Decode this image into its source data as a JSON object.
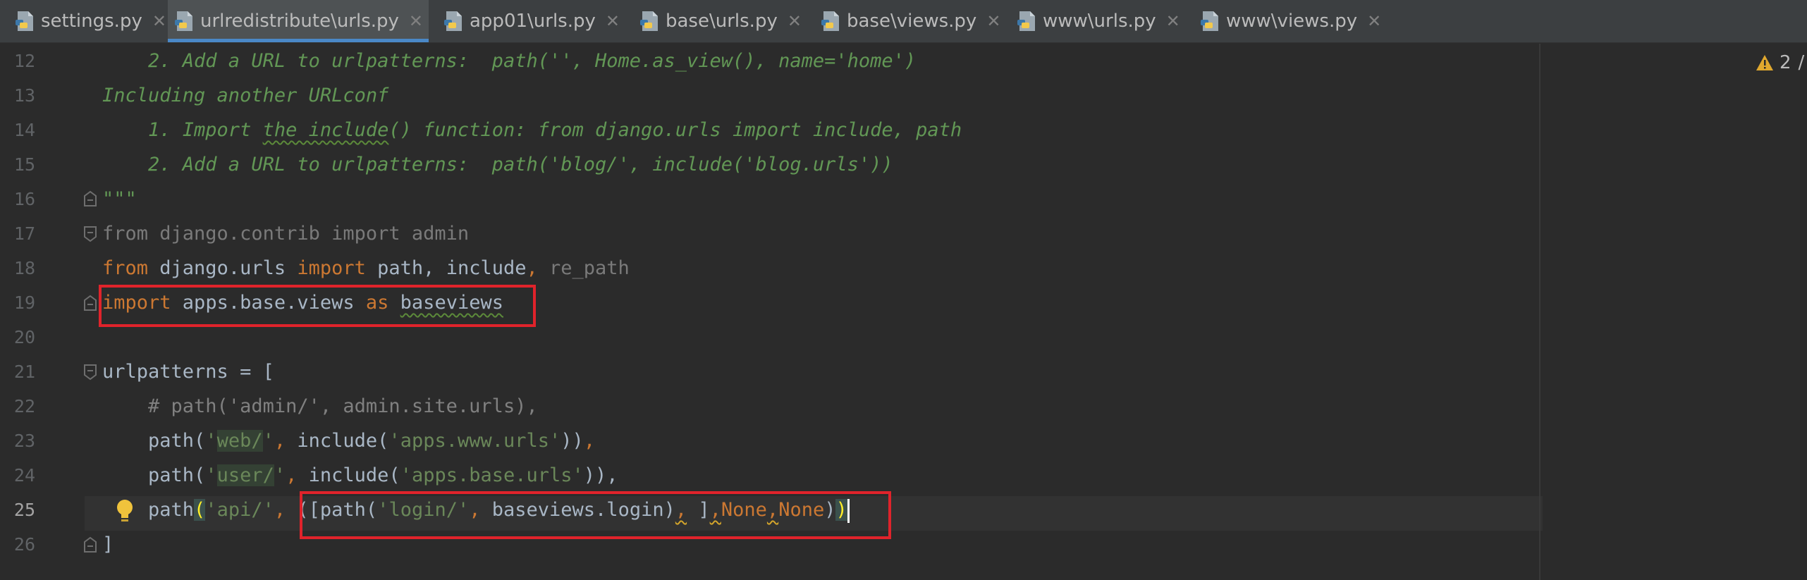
{
  "tabs": [
    {
      "label": "settings.py",
      "active": false
    },
    {
      "label": "urlredistribute\\urls.py",
      "active": true
    },
    {
      "label": "app01\\urls.py",
      "active": false
    },
    {
      "label": "base\\urls.py",
      "active": false
    },
    {
      "label": "base\\views.py",
      "active": false
    },
    {
      "label": "www\\urls.py",
      "active": false
    },
    {
      "label": "www\\views.py",
      "active": false
    }
  ],
  "tab_close_glyph": "✕",
  "line_numbers": [
    "12",
    "13",
    "14",
    "15",
    "16",
    "17",
    "18",
    "19",
    "20",
    "21",
    "22",
    "23",
    "24",
    "25",
    "26"
  ],
  "current_line": "25",
  "warnings": {
    "count": "2",
    "icon": "warning-triangle-icon",
    "trailing": "/"
  },
  "code": {
    "l12": "    2. Add a URL to urlpatterns:  path('', Home.as_view(), name='home')",
    "l13": "Including another URLconf",
    "l14_a": "    1. Import ",
    "l14_b": "the include",
    "l14_c": "() function: from django.urls import include, path",
    "l15": "    2. Add a URL to urlpatterns:  path('blog/', include('blog.urls'))",
    "l16": "\"\"\"",
    "l17": "from django.contrib import admin",
    "l18_from": "from",
    "l18_mod": " django.urls ",
    "l18_import": "import",
    "l18_names": " path, include",
    "l18_comma": ",",
    "l18_re": " re_path",
    "l19_import": "import",
    "l19_mod": " apps.base.views ",
    "l19_as": "as",
    "l19_sp": " ",
    "l19_alias": "baseviews",
    "l21": "urlpatterns = [",
    "l22": "    # path('admin/', admin.site.urls),",
    "l23_a": "    path(",
    "l23_q1": "'",
    "l23_s": "web/",
    "l23_q2": "'",
    "l23_comma": ",",
    "l23_b": " include(",
    "l23_str": "'apps.www.urls'",
    "l23_c": "))",
    "l23_d": ",",
    "l24_a": "    path(",
    "l24_q1": "'",
    "l24_s": "user/",
    "l24_q2": "'",
    "l24_comma": ",",
    "l24_b": " include(",
    "l24_str": "'apps.base.urls'",
    "l24_c": ")),",
    "l25_a": "    path",
    "l25_paren": "(",
    "l25_str1": "'api/'",
    "l25_comma1": ",",
    "l25_sp": " ",
    "l25_b": "([path(",
    "l25_str2": "'login/'",
    "l25_comma2": ",",
    "l25_c": " baseviews.login)",
    "l25_w1": ",",
    "l25_d": " ]",
    "l25_w2": ",",
    "l25_none1": "None",
    "l25_w3": ",",
    "l25_none2": "None",
    "l25_e": ")",
    "l25_close": ")",
    "l26": "]"
  }
}
